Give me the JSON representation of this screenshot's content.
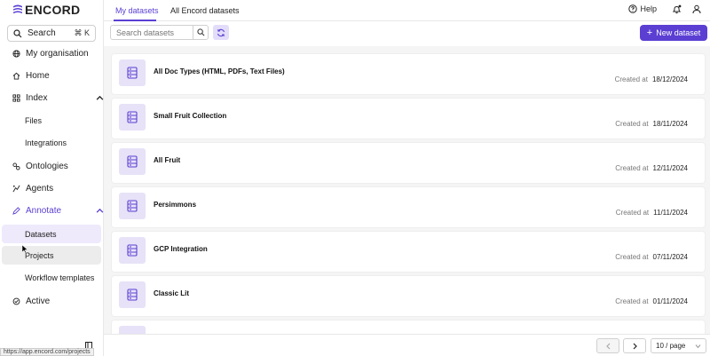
{
  "brand": {
    "logo_text": "ENCORD"
  },
  "sidebar": {
    "search": {
      "label": "Search",
      "shortcut": "⌘ K"
    },
    "items": [
      {
        "label": "My organisation",
        "icon": "globe-icon"
      },
      {
        "label": "Home",
        "icon": "home-icon"
      },
      {
        "label": "Index",
        "icon": "grid-icon"
      },
      {
        "label": "Ontologies",
        "icon": "ontology-icon"
      },
      {
        "label": "Agents",
        "icon": "agents-icon"
      },
      {
        "label": "Annotate",
        "icon": "annotate-icon"
      },
      {
        "label": "Active",
        "icon": "active-icon"
      }
    ],
    "index_sub": [
      {
        "label": "Files"
      },
      {
        "label": "Integrations"
      }
    ],
    "annotate_sub": [
      {
        "label": "Datasets"
      },
      {
        "label": "Projects"
      },
      {
        "label": "Workflow templates"
      }
    ]
  },
  "status_url": "https://app.encord.com/projects",
  "topbar": {
    "tabs": [
      {
        "label": "My datasets"
      },
      {
        "label": "All Encord datasets"
      }
    ],
    "help_label": "Help"
  },
  "toolbar": {
    "search_placeholder": "Search datasets",
    "new_button_label": "New dataset"
  },
  "datasets": [
    {
      "title": "All Doc Types (HTML, PDFs, Text Files)",
      "created_label": "Created at",
      "created": "18/12/2024"
    },
    {
      "title": "Small Fruit Collection",
      "created_label": "Created at",
      "created": "18/11/2024"
    },
    {
      "title": "All Fruit",
      "created_label": "Created at",
      "created": "12/11/2024"
    },
    {
      "title": "Persimmons",
      "created_label": "Created at",
      "created": "11/11/2024"
    },
    {
      "title": "GCP Integration",
      "created_label": "Created at",
      "created": "07/11/2024"
    },
    {
      "title": "Classic Lit",
      "created_label": "Created at",
      "created": "01/11/2024"
    }
  ],
  "pagination": {
    "page_size": "10 / page"
  },
  "colors": {
    "accent": "#5b3fd3",
    "accent_light": "#e7e2f7"
  }
}
